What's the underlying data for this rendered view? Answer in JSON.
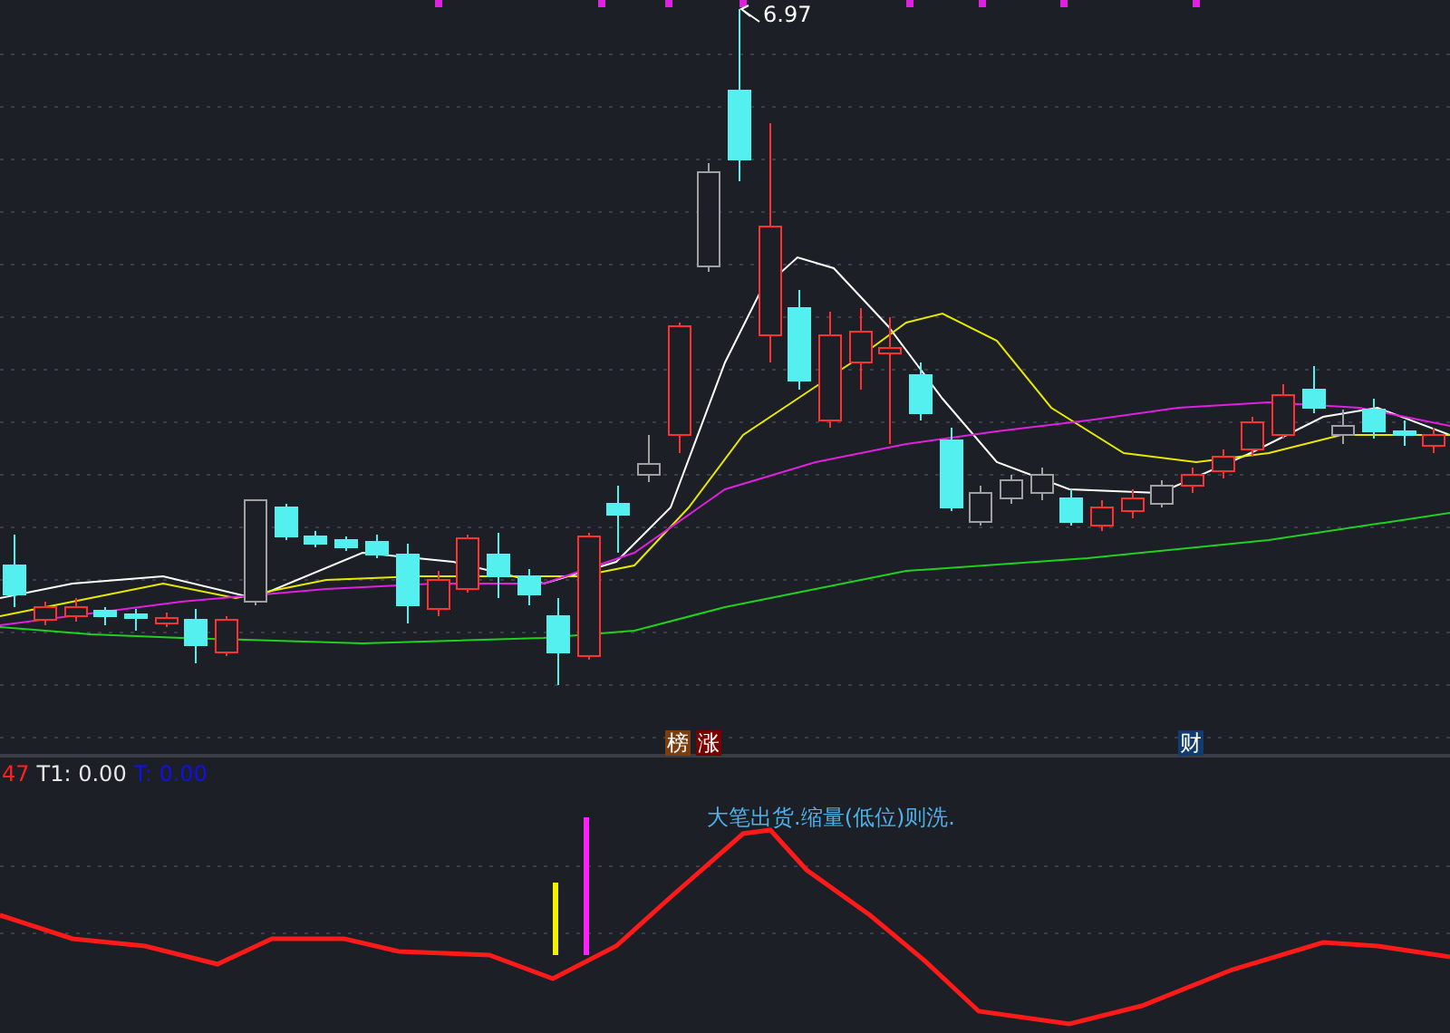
{
  "high_label": "6.97",
  "event_badges": [
    {
      "text": "榜",
      "color": "#7a3e10"
    },
    {
      "text": "涨",
      "color": "#7a0000"
    },
    {
      "text": "财",
      "color": "#123c6e"
    }
  ],
  "indicator_legend": [
    {
      "text": "47",
      "color": "#ff2020"
    },
    {
      "text": "T1: 0.00",
      "color": "#e8e8e8"
    },
    {
      "text": "T: 0.00",
      "color": "#1010ee"
    }
  ],
  "annotation": "大笔出货.缩量(低位)则洗."
}
